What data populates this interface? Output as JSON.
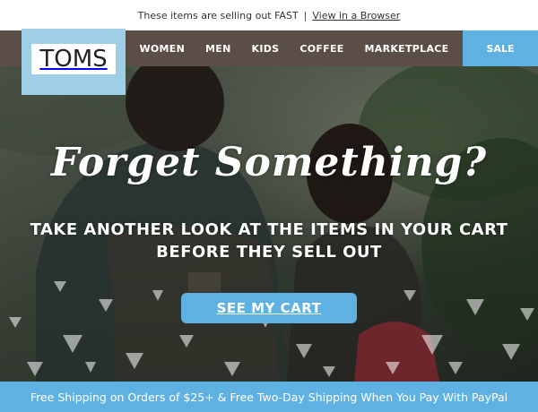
{
  "preheader": {
    "text": "These items are selling out FAST",
    "separator": "|",
    "link_label": "View in a Browser"
  },
  "logo": {
    "text": "TOMS"
  },
  "nav": {
    "items": [
      {
        "label": "WOMEN"
      },
      {
        "label": "MEN"
      },
      {
        "label": "KIDS"
      },
      {
        "label": "COFFEE"
      },
      {
        "label": "MARKETPLACE"
      }
    ],
    "sale_label": "SALE"
  },
  "hero": {
    "headline": "Forget Something?",
    "subhead_line1": "TAKE ANOTHER LOOK AT THE ITEMS IN YOUR CART",
    "subhead_line2": "BEFORE THEY SELL OUT",
    "cta_label": "SEE MY CART"
  },
  "footer": {
    "text": "Free Shipping on Orders of $25+ & Free Two-Day Shipping When You Pay With PayPal"
  },
  "colors": {
    "nav_bg": "#5b4e47",
    "accent_blue": "#5eb1e0",
    "logo_bg": "#9ecfe6"
  }
}
